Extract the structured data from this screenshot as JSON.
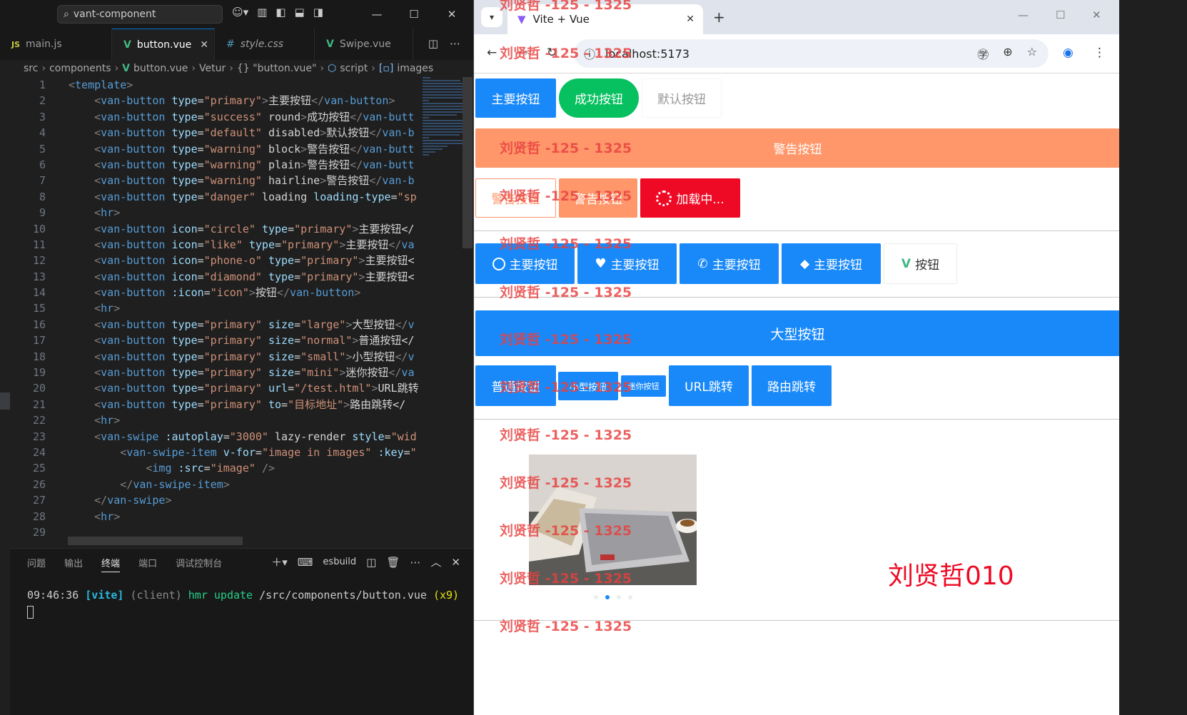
{
  "vscode": {
    "search_text": "vant-component",
    "tabs": [
      {
        "icon": "JS",
        "label": "main.js"
      },
      {
        "icon": "V",
        "label": "button.vue"
      },
      {
        "icon": "#",
        "label": "style.css"
      },
      {
        "icon": "V",
        "label": "Swipe.vue"
      }
    ],
    "breadcrumb": [
      "src",
      "components",
      "button.vue",
      "Vetur",
      "{} \"button.vue\"",
      "script",
      "images"
    ],
    "code_lines": [
      "<template>",
      "    <van-button type=\"primary\">主要按钮</van-button>",
      "    <van-button type=\"success\" round>成功按钮</van-butt",
      "    <van-button type=\"default\" disabled>默认按钮</van-b",
      "    <van-button type=\"warning\" block>警告按钮</van-butt",
      "    <van-button type=\"warning\" plain>警告按钮</van-butt",
      "    <van-button type=\"warning\" hairline>警告按钮</van-b",
      "    <van-button type=\"danger\" loading loading-type=\"sp",
      "    <hr>",
      "    <van-button icon=\"circle\" type=\"primary\">主要按钮</",
      "    <van-button icon=\"like\" type=\"primary\">主要按钮</va",
      "    <van-button icon=\"phone-o\" type=\"primary\">主要按钮<",
      "    <van-button icon=\"diamond\" type=\"primary\">主要按钮<",
      "    <van-button :icon=\"icon\">按钮</van-button>",
      "    <hr>",
      "    <van-button type=\"primary\" size=\"large\">大型按钮</v",
      "    <van-button type=\"primary\" size=\"normal\">普通按钮</",
      "    <van-button type=\"primary\" size=\"small\">小型按钮</v",
      "    <van-button type=\"primary\" size=\"mini\">迷你按钮</va",
      "    <van-button type=\"primary\" url=\"/test.html\">URL跳转",
      "    <van-button type=\"primary\" to=\"目标地址\">路由跳转</",
      "    <hr>",
      "    <van-swipe :autoplay=\"3000\" lazy-render style=\"wid",
      "        <van-swipe-item v-for=\"image in images\" :key=\"",
      "            <img :src=\"image\" />",
      "        </van-swipe-item>",
      "    </van-swipe>",
      "    <hr>",
      ""
    ],
    "panel_tabs": [
      "问题",
      "输出",
      "终端",
      "端口",
      "调试控制台"
    ],
    "terminal_profile": "esbuild",
    "terminal": {
      "time": "09:46:36",
      "tag": "[vite]",
      "scope": "(client)",
      "msg": "hmr update",
      "path": "/src/components/button.vue",
      "count": "(x9)"
    }
  },
  "browser": {
    "tab_title": "Vite + Vue",
    "url": "localhost:5173",
    "page": {
      "row1": [
        "主要按钮",
        "成功按钮",
        "默认按钮"
      ],
      "block_warning": "警告按钮",
      "row3": [
        "警告按钮",
        "警告按钮",
        "加载中..."
      ],
      "icon_row": [
        "主要按钮",
        "主要按钮",
        "主要按钮",
        "主要按钮",
        "按钮"
      ],
      "large": "大型按钮",
      "size_row": [
        "普通按钮",
        "小型按钮",
        "迷你按钮",
        "URL跳转",
        "路由跳转"
      ],
      "signature": "刘贤哲010"
    },
    "watermark_text": "刘贤哲 -125 - 1325"
  },
  "colors": {
    "primary": "#1989fa",
    "success": "#07c160",
    "warning": "#ff976a",
    "danger": "#ee0a24"
  }
}
